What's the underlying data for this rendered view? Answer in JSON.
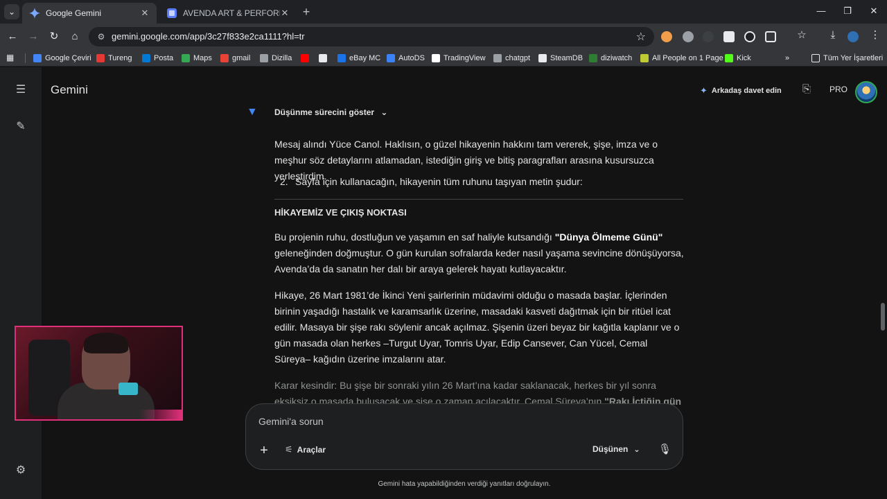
{
  "browser": {
    "tabs": [
      {
        "title": "Google Gemini",
        "active": true
      },
      {
        "title": "AVENDA ART & PERFORMANCE",
        "active": false
      }
    ],
    "url": "gemini.google.com/app/3c27f833e2ca1111?hl=tr",
    "bookmarks": [
      {
        "label": "Google Çeviri",
        "color": "#4285f4"
      },
      {
        "label": "Tureng",
        "color": "#e53935"
      },
      {
        "label": "Posta",
        "color": "#0078d4"
      },
      {
        "label": "Maps",
        "color": "#34a853"
      },
      {
        "label": "gmail",
        "color": "#ea4335"
      },
      {
        "label": "Dizilla",
        "color": "#9aa0a6"
      },
      {
        "label": "",
        "color": "#ff0000"
      },
      {
        "label": "",
        "color": "#e8eaed"
      },
      {
        "label": "eBay MC",
        "color": "#1a73e8"
      },
      {
        "label": "AutoDS",
        "color": "#3b82f6"
      },
      {
        "label": "TradingView",
        "color": "#ffffff"
      },
      {
        "label": "chatgpt",
        "color": "#9aa0a6"
      },
      {
        "label": "SteamDB",
        "color": "#e8eaed"
      },
      {
        "label": "diziwatch",
        "color": "#2e7d32"
      },
      {
        "label": "All People on 1 Page",
        "color": "#c0ca33"
      },
      {
        "label": "Kick",
        "color": "#53fc18"
      }
    ],
    "bookmarks_folder": "Tüm Yer İşaretleri"
  },
  "app": {
    "title": "Gemini",
    "invite": "Arkadaş davet edin",
    "pro": "PRO"
  },
  "chat": {
    "thinking_toggle": "Düşünme sürecini göster",
    "intro": "Mesaj alındı Yüce Canol. Haklısın, o güzel hikayenin hakkını tam vererek, şişe, imza ve o meşhur söz detaylarını atlamadan, istediğin giriş ve bitiş paragrafları arasına kusursuzca yerleştirdim.",
    "list_number": "2.",
    "list_text": "Sayfa için kullanacağın, hikayenin tüm ruhunu taşıyan metin şudur:",
    "heading": "HİKAYEMİZ VE ÇIKIŞ NOKTASI",
    "p1_before": "Bu projenin ruhu, dostluğun ve yaşamın en saf haliyle kutsandığı ",
    "p1_bold": "\"Dünya Ölmeme Günü\"",
    "p1_after": " geleneğinden doğmuştur. O gün kurulan sofralarda keder nasıl yaşama sevincine dönüşüyorsa, Avenda’da da sanatın her dalı bir araya gelerek hayatı kutlayacaktır.",
    "p2": "Hikaye, 26 Mart 1981’de İkinci Yeni şairlerinin müdavimi olduğu o masada başlar. İçlerinden birinin yaşadığı hastalık ve karamsarlık üzerine, masadaki kasveti dağıtmak için bir ritüel icat edilir. Masaya bir şişe rakı söylenir ancak açılmaz. Şişenin üzeri beyaz bir kağıtla kaplanır ve o gün masada olan herkes –Turgut Uyar, Tomris Uyar, Edip Cansever, Can Yücel, Cemal Süreya– kağıdın üzerine imzalarını atar.",
    "p3_before": "Karar kesindir: Bu şişe bir sonraki yılın 26 Mart’ına kadar saklanacak, herkes bir yıl sonra eksiksiz o masada buluşacak ve şişe o zaman açılacaktır. Cemal Süreya’nın ",
    "p3_bold": "\"Rakı İçtiğin gün ölmezsin\""
  },
  "prompt": {
    "placeholder": "Gemini'a sorun",
    "tools": "Araçlar",
    "model": "Düşünen"
  },
  "disclaimer": "Gemini hata yapabildiğinden verdiği yanıtları doğrulayın."
}
